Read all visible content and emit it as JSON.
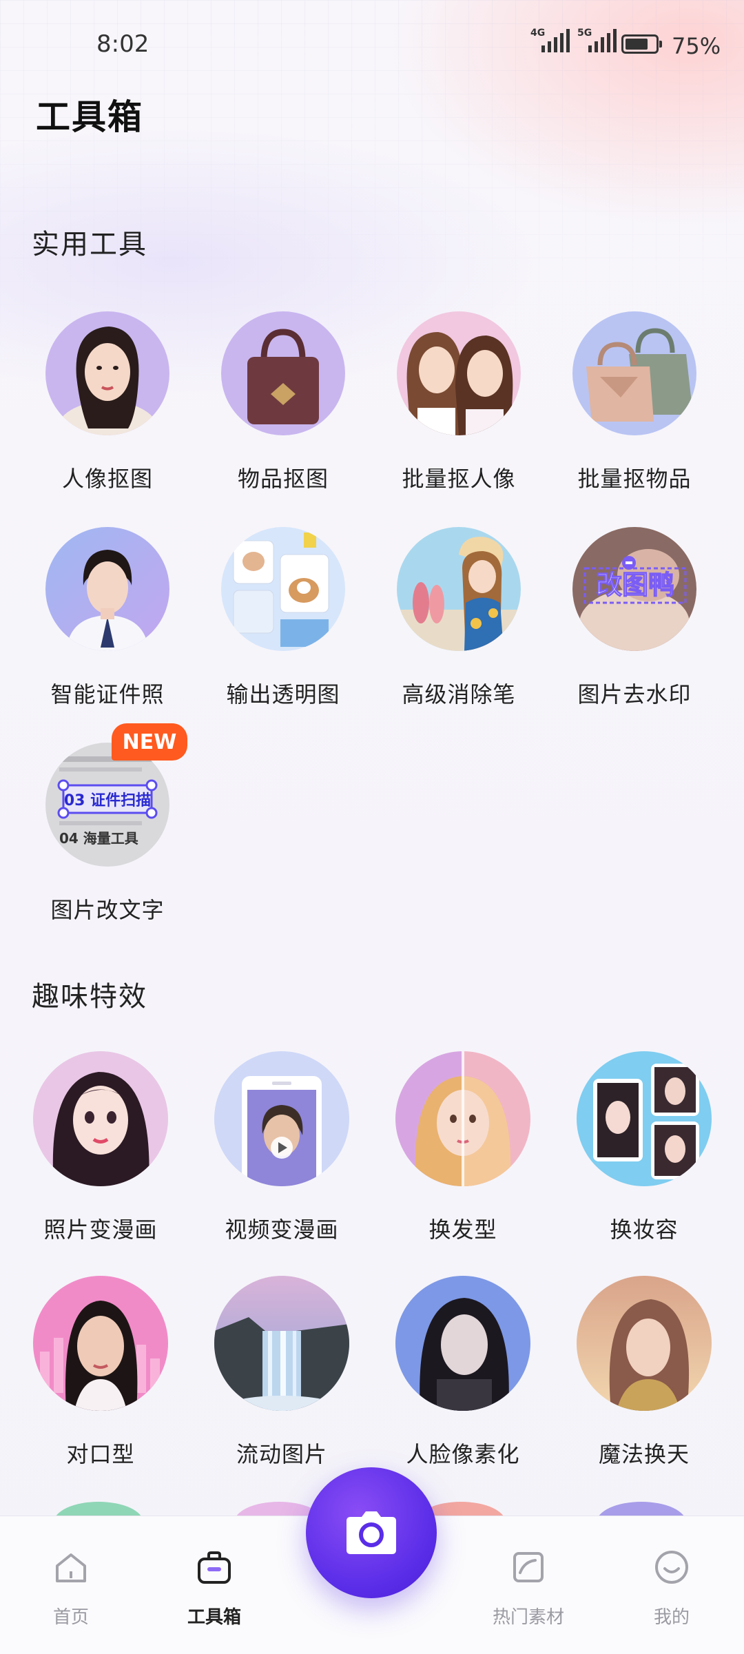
{
  "status": {
    "time": "8:02",
    "net1": "4G",
    "net2": "5G",
    "battery_text": "75%",
    "battery_level": 0.75
  },
  "header": {
    "title": "工具箱"
  },
  "sections": [
    {
      "title": "实用工具",
      "items": [
        {
          "label": "人像抠图"
        },
        {
          "label": "物品抠图"
        },
        {
          "label": "批量抠人像"
        },
        {
          "label": "批量抠物品"
        },
        {
          "label": "智能证件照"
        },
        {
          "label": "输出透明图"
        },
        {
          "label": "高级消除笔"
        },
        {
          "label": "图片去水印",
          "art_text": "改图鸭"
        },
        {
          "label": "图片改文字",
          "badge": "NEW",
          "art_text": [
            "03 证件扫描",
            "04 海量工具"
          ]
        }
      ]
    },
    {
      "title": "趣味特效",
      "items": [
        {
          "label": "照片变漫画"
        },
        {
          "label": "视频变漫画"
        },
        {
          "label": "换发型"
        },
        {
          "label": "换妆容"
        },
        {
          "label": "对口型"
        },
        {
          "label": "流动图片"
        },
        {
          "label": "人脸像素化"
        },
        {
          "label": "魔法换天"
        }
      ]
    }
  ],
  "nav": [
    {
      "label": "首页",
      "icon": "home-icon"
    },
    {
      "label": "工具箱",
      "icon": "toolbox-icon",
      "active": true
    },
    {
      "label": "热门素材",
      "icon": "trending-icon"
    },
    {
      "label": "我的",
      "icon": "smile-icon"
    }
  ],
  "fab": {
    "icon": "camera-icon"
  },
  "colors": {
    "accent": "#5a2de8",
    "badge": "#ff5a1f"
  }
}
